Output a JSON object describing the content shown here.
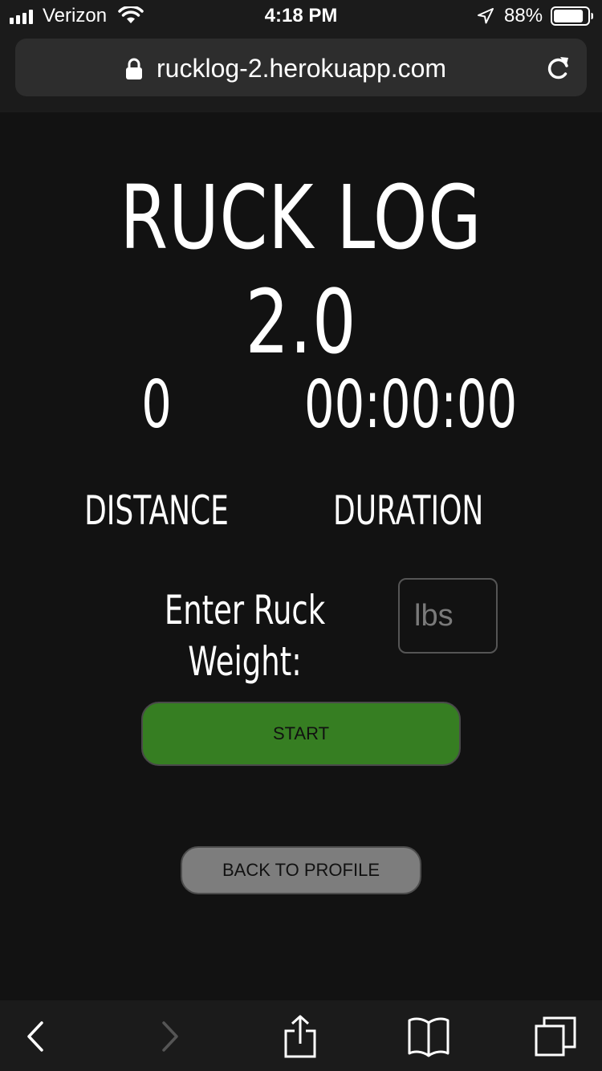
{
  "status_bar": {
    "carrier": "Verizon",
    "time": "4:18 PM",
    "battery_percent": "88%",
    "battery_level": 0.88,
    "icons": [
      "signal-icon",
      "wifi-icon",
      "location-arrow-icon",
      "battery-icon"
    ]
  },
  "browser": {
    "url": "rucklog-2.herokuapp.com",
    "icons": [
      "lock-icon",
      "reload-icon"
    ]
  },
  "page": {
    "title": "RUCK LOG 2.0",
    "distance_value": "0",
    "duration_value": "00:00:00",
    "distance_label": "DISTANCE",
    "duration_label": "DURATION",
    "weight_label": "Enter Ruck Weight:",
    "weight_placeholder": "lbs",
    "start_label": "START",
    "back_label": "BACK TO PROFILE"
  },
  "toolbar": {
    "icons": [
      "back-arrow-icon",
      "forward-arrow-icon",
      "share-icon",
      "bookmarks-icon",
      "tabs-icon"
    ]
  },
  "colors": {
    "background": "#121212",
    "chrome": "#1b1b1b",
    "url_bar": "#2d2d2d",
    "start_button": "#367e22",
    "back_button": "#7d7d7d",
    "disabled_icon": "#555555"
  }
}
